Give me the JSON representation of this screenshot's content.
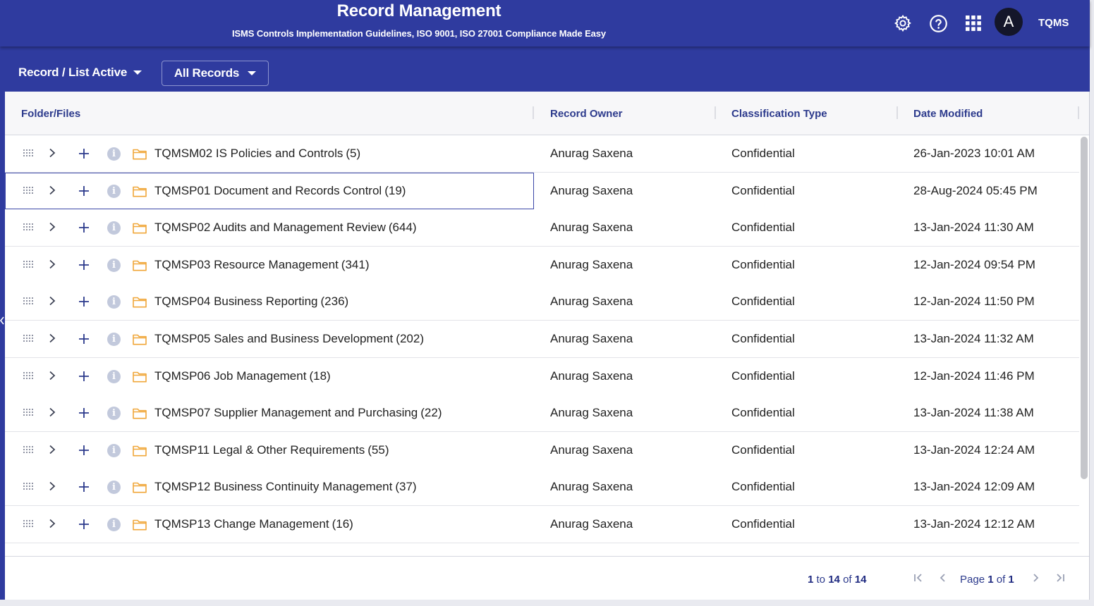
{
  "header": {
    "title": "Record Management",
    "subtitle": "ISMS Controls Implementation Guidelines, ISO 9001, ISO 27001 Compliance Made Easy",
    "avatar_initial": "A",
    "brand": "TQMS"
  },
  "toolbar": {
    "view_label": "Record / List Active",
    "filter_label": "All Records"
  },
  "columns": {
    "folder": "Folder/Files",
    "owner": "Record Owner",
    "classification": "Classification Type",
    "date": "Date Modified"
  },
  "rows": [
    {
      "name": "TQMSM02 IS Policies and Controls",
      "count": "(5)",
      "owner": "Anurag Saxena",
      "classification": "Confidential",
      "date": "26-Jan-2023 10:01 AM"
    },
    {
      "name": "TQMSP01 Document and Records Control",
      "count": "(19)",
      "owner": "Anurag Saxena",
      "classification": "Confidential",
      "date": "28-Aug-2024 05:45 PM"
    },
    {
      "name": "TQMSP02 Audits and Management Review",
      "count": "(644)",
      "owner": "Anurag Saxena",
      "classification": "Confidential",
      "date": "13-Jan-2024 11:30 AM"
    },
    {
      "name": "TQMSP03 Resource Management",
      "count": "(341)",
      "owner": "Anurag Saxena",
      "classification": "Confidential",
      "date": "12-Jan-2024 09:54 PM"
    },
    {
      "name": "TQMSP04 Business Reporting",
      "count": "(236)",
      "owner": "Anurag Saxena",
      "classification": "Confidential",
      "date": "12-Jan-2024 11:50 PM"
    },
    {
      "name": "TQMSP05 Sales and Business Development",
      "count": "(202)",
      "owner": "Anurag Saxena",
      "classification": "Confidential",
      "date": "13-Jan-2024 11:32 AM"
    },
    {
      "name": "TQMSP06 Job Management",
      "count": "(18)",
      "owner": "Anurag Saxena",
      "classification": "Confidential",
      "date": "12-Jan-2024 11:46 PM"
    },
    {
      "name": "TQMSP07 Supplier Management and Purchasing",
      "count": "(22)",
      "owner": "Anurag Saxena",
      "classification": "Confidential",
      "date": "13-Jan-2024 11:38 AM"
    },
    {
      "name": "TQMSP11 Legal & Other Requirements",
      "count": "(55)",
      "owner": "Anurag Saxena",
      "classification": "Confidential",
      "date": "13-Jan-2024 12:24 AM"
    },
    {
      "name": "TQMSP12 Business Continuity Management",
      "count": "(37)",
      "owner": "Anurag Saxena",
      "classification": "Confidential",
      "date": "13-Jan-2024 12:09 AM"
    },
    {
      "name": "TQMSP13 Change Management",
      "count": "(16)",
      "owner": "Anurag Saxena",
      "classification": "Confidential",
      "date": "13-Jan-2024 12:12 AM"
    }
  ],
  "pager": {
    "from": "1",
    "to_word": "to",
    "to": "14",
    "of_word": "of",
    "total": "14",
    "page_word": "Page",
    "page": "1",
    "pages_word": "of",
    "pages": "1"
  },
  "colors": {
    "brand_blue": "#2f3b9f",
    "header_text": "#2c3a8c",
    "folder_orange": "#f0a73a"
  },
  "icons": [
    "gear-icon",
    "help-icon",
    "apps-grid-icon",
    "drag-handle-icon",
    "chevron-right-icon",
    "plus-icon",
    "info-icon",
    "folder-icon",
    "first-page-icon",
    "previous-page-icon",
    "next-page-icon",
    "last-page-icon"
  ]
}
